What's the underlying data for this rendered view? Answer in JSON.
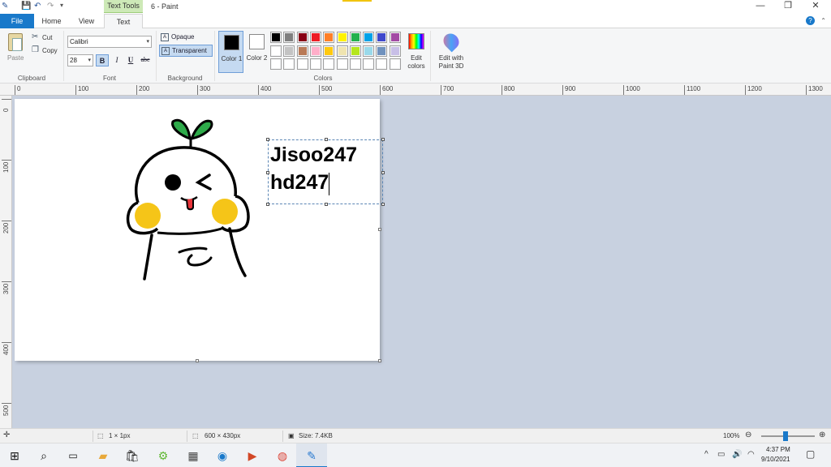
{
  "window": {
    "title": "6 - Paint",
    "contextual_tab_group": "Text Tools",
    "minimize_glyph": "—",
    "maximize_glyph": "❐",
    "close_glyph": "✕"
  },
  "tabs": {
    "file": "File",
    "home": "Home",
    "view": "View",
    "text": "Text"
  },
  "ribbon": {
    "clipboard": {
      "paste": "Paste",
      "cut": "Cut",
      "copy": "Copy",
      "label": "Clipboard"
    },
    "font": {
      "family": "Calibri",
      "size": "28",
      "bold": "B",
      "italic": "I",
      "underline": "U",
      "strikethrough": "abc",
      "label": "Font"
    },
    "background": {
      "opaque": "Opaque",
      "transparent": "Transparent",
      "selected": "Transparent",
      "label": "Background"
    },
    "colors": {
      "color1_label": "Color 1",
      "color2_label": "Color 2",
      "color1": "#000000",
      "color2": "#ffffff",
      "edit_colors": "Edit colors",
      "edit_with_paint3d": "Edit with Paint 3D",
      "label": "Colors",
      "palette_row1": [
        "#000000",
        "#7f7f7f",
        "#880015",
        "#ed1c24",
        "#ff7f27",
        "#fff200",
        "#22b14c",
        "#00a2e8",
        "#3f48cc",
        "#a349a4"
      ],
      "palette_row2": [
        "#ffffff",
        "#c3c3c3",
        "#b97a57",
        "#ffaec9",
        "#ffc90e",
        "#efe4b0",
        "#b5e61d",
        "#99d9ea",
        "#7092be",
        "#c8bfe7"
      ],
      "palette_row3": [
        "#ffffff",
        "#ffffff",
        "#ffffff",
        "#ffffff",
        "#ffffff",
        "#ffffff",
        "#ffffff",
        "#ffffff",
        "#ffffff",
        "#ffffff"
      ]
    }
  },
  "ruler": {
    "top": [
      "0",
      "100",
      "200",
      "300",
      "400",
      "500",
      "600",
      "700",
      "800",
      "900",
      "1000",
      "1100",
      "1200",
      "1300"
    ],
    "left": [
      "0",
      "100",
      "200",
      "300",
      "400",
      "500"
    ]
  },
  "canvas": {
    "text_lines": [
      "Jisoo247",
      "hd247"
    ]
  },
  "statusbar": {
    "selection_size": "1 × 1px",
    "canvas_size": "600 × 430px",
    "file_size": "Size: 7.4KB",
    "zoom": "100%"
  },
  "taskbar": {
    "time": "4:37 PM",
    "date": "9/10/2021"
  }
}
